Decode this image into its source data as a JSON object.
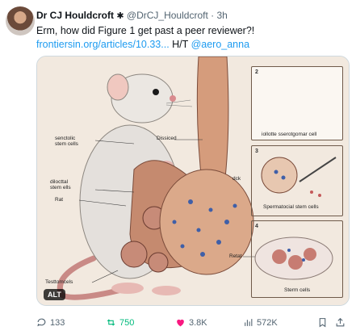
{
  "author": {
    "name": "Dr CJ Houldcroft",
    "handle": "@DrCJ_Houldcroft",
    "time": "3h",
    "separator": "·"
  },
  "tweet": {
    "text": "Erm, how did Figure 1 get past a peer reviewer?!",
    "link": "frontiersin.org/articles/10.33...",
    "ht": "H/T",
    "mention": "@aero_anna"
  },
  "figure": {
    "labels": {
      "stem_cells": "senctolic\nstem cells",
      "dissiced": "Dissiced",
      "dck": "dck",
      "diluctal": "dilocttal\nstem ells",
      "rat": "Rat",
      "testtomcels": "Testtomcels",
      "retat": "Retat"
    },
    "panels": [
      {
        "num": "2",
        "caption": "iollotte sserotgomar cell"
      },
      {
        "num": "3",
        "caption": "Spermatocial stem cells"
      },
      {
        "num": "4",
        "caption": "Sterm cells"
      }
    ],
    "alt_badge": "ALT"
  },
  "actions": {
    "replies": "133",
    "reposts": "750",
    "likes": "3.8K",
    "views": "572K"
  },
  "colors": {
    "link": "#1d9bf0",
    "repost": "#00ba7c",
    "like": "#f91880",
    "muted": "#536471"
  }
}
